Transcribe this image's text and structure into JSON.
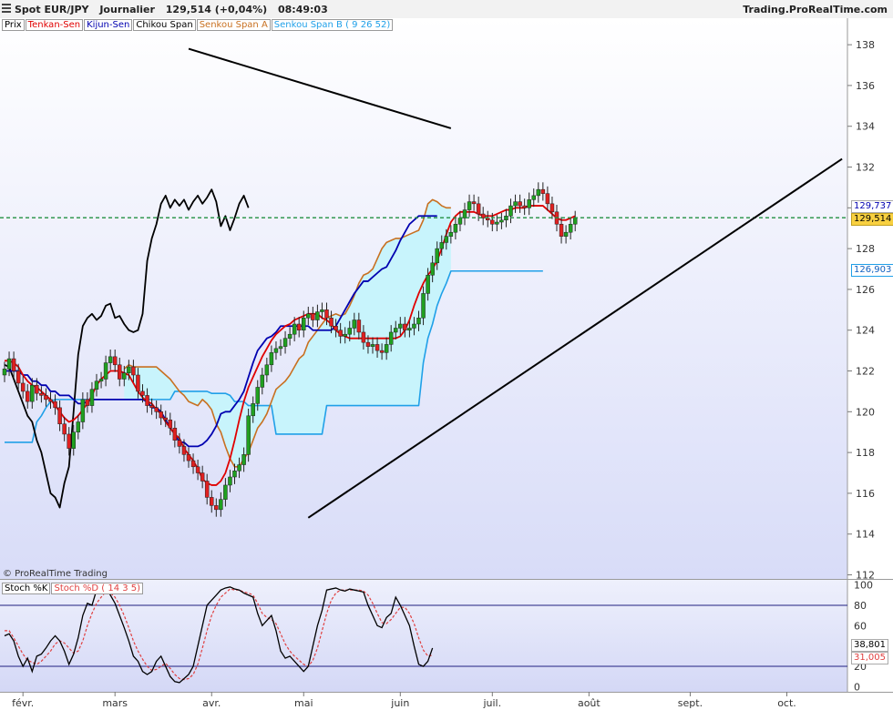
{
  "header": {
    "instrument": "Spot EUR/JPY",
    "timeframe": "Journalier",
    "last": "129,514 (+0,04%)",
    "time": "08:49:03",
    "brand": "Trading.ProRealTime.com"
  },
  "legend": {
    "price": "Prix",
    "tenkan": "Tenkan-Sen",
    "kijun": "Kijun-Sen",
    "chikou": "Chikou Span",
    "spanA": "Senkou Span A",
    "spanB": "Senkou Span B ( 9 26 52)"
  },
  "copyright": "© ProRealTime Trading",
  "stoch_legend": {
    "k": "Stoch %K",
    "d": "Stoch %D ( 14 3 5)"
  },
  "tags": {
    "price": "129,514",
    "spanB": "126,903",
    "hidden": "129,737",
    "k": "38,801",
    "d": "31,005"
  },
  "colors": {
    "tenkan": "#e00000",
    "kijun": "#0000b0",
    "chikou": "#000000",
    "spanA": "#c87020",
    "spanB": "#20a0e8",
    "cloud": "#c8f4fc",
    "up": "#20a020",
    "down": "#e02020",
    "stochD": "#e04040",
    "band": "#202080"
  },
  "chart_data": [
    {
      "type": "candlestick",
      "title": "Spot EUR/JPY",
      "x_ticks": [
        "févr.",
        "mars",
        "avr.",
        "mai",
        "juin",
        "juil.",
        "août",
        "sept.",
        "oct."
      ],
      "y_ticks": [
        112,
        114,
        116,
        118,
        120,
        122,
        124,
        126,
        128,
        130,
        132,
        134,
        136,
        138
      ],
      "ylim": [
        111.8,
        139.3
      ],
      "xlim": [
        0,
        176
      ],
      "month_starts": [
        4,
        24,
        45,
        65,
        86,
        106,
        127,
        149,
        170
      ],
      "current_price": 129.514,
      "closes": [
        122.1,
        122.6,
        122.0,
        121.4,
        121.0,
        120.5,
        121.3,
        120.9,
        120.8,
        120.6,
        120.5,
        120.2,
        119.4,
        118.9,
        118.2,
        119.0,
        119.5,
        120.6,
        120.3,
        121.1,
        121.5,
        121.6,
        122.4,
        122.7,
        122.3,
        121.6,
        121.9,
        122.2,
        121.8,
        121.0,
        120.8,
        120.3,
        120.2,
        120.0,
        119.7,
        119.6,
        119.2,
        118.6,
        118.3,
        117.9,
        117.6,
        117.3,
        117.0,
        116.6,
        115.8,
        115.4,
        115.2,
        115.7,
        116.4,
        116.8,
        117.1,
        117.4,
        117.9,
        119.8,
        120.4,
        121.2,
        121.8,
        122.3,
        122.9,
        123.1,
        123.2,
        123.6,
        123.8,
        124.3,
        124.0,
        124.6,
        124.8,
        124.5,
        124.9,
        125.0,
        124.6,
        124.2,
        124.0,
        123.7,
        123.8,
        124.1,
        124.5,
        123.9,
        123.4,
        123.2,
        123.3,
        123.0,
        122.9,
        123.3,
        123.9,
        124.1,
        124.3,
        124.0,
        124.1,
        124.3,
        124.6,
        125.8,
        126.7,
        127.3,
        128.0,
        128.3,
        128.6,
        128.8,
        129.2,
        129.5,
        129.9,
        130.3,
        130.2,
        129.7,
        129.5,
        129.4,
        129.2,
        129.3,
        129.4,
        129.6,
        130.1,
        130.3,
        130.1,
        130.0,
        130.4,
        130.6,
        130.9,
        130.7,
        130.2,
        129.8,
        129.2,
        128.6,
        128.8,
        129.2,
        129.5
      ],
      "tenkan": [
        122.5,
        122.5,
        122.4,
        122.2,
        121.8,
        121.5,
        121.3,
        121.2,
        121.0,
        120.8,
        120.6,
        120.3,
        120.0,
        119.7,
        119.5,
        119.6,
        119.8,
        120.1,
        120.4,
        120.8,
        121.3,
        121.6,
        121.8,
        122.0,
        122.0,
        122.0,
        121.9,
        121.8,
        121.4,
        121.0,
        120.7,
        120.5,
        120.4,
        120.1,
        119.9,
        119.5,
        119.2,
        118.9,
        118.7,
        118.2,
        117.9,
        117.6,
        117.2,
        116.7,
        116.5,
        116.4,
        116.4,
        116.6,
        117.0,
        117.7,
        118.6,
        119.6,
        120.5,
        121.2,
        121.7,
        122.2,
        122.7,
        123.1,
        123.5,
        123.8,
        124.0,
        124.2,
        124.3,
        124.5,
        124.6,
        124.7,
        124.8,
        124.8,
        124.8,
        124.6,
        124.5,
        124.3,
        124.0,
        123.8,
        123.7,
        123.6,
        123.6,
        123.6,
        123.6,
        123.6,
        123.6,
        123.6,
        123.6,
        123.6,
        123.6,
        123.6,
        123.7,
        124.0,
        124.5,
        125.2,
        125.8,
        126.3,
        126.7,
        127.0,
        127.4,
        128.0,
        128.7,
        129.3,
        129.6,
        129.8,
        129.8,
        129.8,
        129.8,
        129.7,
        129.6,
        129.6,
        129.6,
        129.7,
        129.8,
        129.9,
        129.9,
        130.0,
        130.0,
        130.0,
        130.1,
        130.1,
        130.1,
        130.1,
        129.9,
        129.7,
        129.5,
        129.4,
        129.4,
        129.5,
        129.6
      ],
      "kijun": [
        122.0,
        122.0,
        122.0,
        122.0,
        121.8,
        121.8,
        121.5,
        121.5,
        121.3,
        121.3,
        121.0,
        121.0,
        120.8,
        120.8,
        120.8,
        120.6,
        120.4,
        120.4,
        120.5,
        120.6,
        120.6,
        120.6,
        120.6,
        120.6,
        120.6,
        120.6,
        120.6,
        120.6,
        120.6,
        120.6,
        120.6,
        120.5,
        120.2,
        120.2,
        120.0,
        119.6,
        119.2,
        118.9,
        118.5,
        118.5,
        118.3,
        118.3,
        118.3,
        118.4,
        118.6,
        118.9,
        119.3,
        119.9,
        120.0,
        120.0,
        120.3,
        120.6,
        121.0,
        121.7,
        122.4,
        123.0,
        123.3,
        123.6,
        123.7,
        123.9,
        124.2,
        124.2,
        124.2,
        124.2,
        124.2,
        124.2,
        124.2,
        124.0,
        124.0,
        124.0,
        124.0,
        124.0,
        124.2,
        124.6,
        125.0,
        125.4,
        125.8,
        126.1,
        126.4,
        126.4,
        126.6,
        126.8,
        127.0,
        127.1,
        127.5,
        127.9,
        128.4,
        128.8,
        129.2,
        129.4,
        129.6,
        129.6,
        129.6,
        129.6,
        129.6
      ],
      "chikou": [
        122.3,
        122.2,
        121.6,
        121.0,
        120.4,
        119.8,
        119.5,
        118.6,
        118.0,
        117.0,
        116.0,
        115.8,
        115.3,
        116.5,
        117.3,
        120.0,
        122.8,
        124.2,
        124.6,
        124.8,
        124.5,
        124.7,
        125.2,
        125.3,
        124.6,
        124.7,
        124.3,
        124.0,
        123.9,
        124.0,
        124.8,
        127.4,
        128.5,
        129.2,
        130.2,
        130.6,
        130.0,
        130.4,
        130.1,
        130.4,
        129.9,
        130.3,
        130.6,
        130.2,
        130.5,
        130.9,
        130.3,
        129.1,
        129.6,
        128.9,
        129.5,
        130.2,
        130.6,
        130.0
      ],
      "spanA": [
        122.1,
        122.3,
        122.2,
        122.2,
        122.2,
        122.2,
        122.2,
        122.2,
        122.0,
        121.8,
        121.6,
        121.3,
        121.0,
        120.8,
        120.5,
        120.4,
        120.3,
        120.6,
        120.4,
        120.1,
        119.4,
        119.0,
        118.3,
        117.7,
        117.3,
        117.3,
        117.7,
        118.0,
        118.6,
        119.2,
        119.5,
        119.9,
        120.5,
        121.1,
        121.3,
        121.5,
        121.8,
        122.2,
        122.6,
        122.8,
        123.4,
        123.7,
        124.0,
        124.3,
        124.6,
        124.7,
        124.8,
        124.7,
        124.8,
        125.2,
        125.7,
        126.3,
        126.7,
        126.8,
        127.0,
        127.5,
        128.0,
        128.3,
        128.4,
        128.5,
        128.5,
        128.6,
        128.7,
        128.8,
        128.9,
        129.4,
        130.2,
        130.4,
        130.3,
        130.1,
        130.0,
        130.0
      ],
      "spanB": [
        118.5,
        118.5,
        118.5,
        118.5,
        118.5,
        118.5,
        118.5,
        119.5,
        119.8,
        120.2,
        120.5,
        120.6,
        120.6,
        120.6,
        120.6,
        120.6,
        120.6,
        120.6,
        120.6,
        120.6,
        120.6,
        120.6,
        120.6,
        120.6,
        120.6,
        120.6,
        120.6,
        120.6,
        120.6,
        120.6,
        120.6,
        120.6,
        120.6,
        120.6,
        120.6,
        120.6,
        120.6,
        121.0,
        121.0,
        121.0,
        121.0,
        121.0,
        121.0,
        121.0,
        121.0,
        120.9,
        120.9,
        120.9,
        120.9,
        120.8,
        120.5,
        120.5,
        120.5,
        120.3,
        120.3,
        120.3,
        120.3,
        120.3,
        120.3,
        118.9,
        118.9,
        118.9,
        118.9,
        118.9,
        118.9,
        118.9,
        118.9,
        118.9,
        118.9,
        118.9,
        120.3,
        120.3,
        120.3,
        120.3,
        120.3,
        120.3,
        120.3,
        120.3,
        120.3,
        120.3,
        120.3,
        120.3,
        120.3,
        120.3,
        120.3,
        120.3,
        120.3,
        120.3,
        120.3,
        120.3,
        120.3,
        122.4,
        123.6,
        124.3,
        125.2,
        125.8,
        126.3,
        126.9,
        126.9,
        126.9,
        126.9,
        126.9,
        126.9,
        126.9,
        126.9,
        126.9,
        126.9,
        126.9,
        126.9,
        126.9,
        126.9,
        126.9,
        126.9,
        126.9,
        126.9,
        126.9,
        126.9,
        126.9
      ],
      "trendlines": [
        {
          "from": [
            40,
            137.8
          ],
          "to": [
            97,
            133.9
          ]
        },
        {
          "from": [
            66,
            114.8
          ],
          "to": [
            182,
            132.4
          ]
        }
      ]
    },
    {
      "type": "line",
      "title": "Stoch %K",
      "y_ticks": [
        0,
        20,
        40,
        60,
        80,
        100
      ],
      "ylim": [
        -5,
        105
      ],
      "bands": [
        20,
        80
      ],
      "k": [
        50,
        52,
        45,
        30,
        20,
        28,
        15,
        30,
        32,
        38,
        45,
        50,
        45,
        35,
        22,
        32,
        48,
        70,
        82,
        80,
        95,
        98,
        97,
        90,
        82,
        70,
        58,
        45,
        30,
        25,
        15,
        12,
        15,
        25,
        30,
        20,
        10,
        5,
        4,
        8,
        12,
        20,
        40,
        60,
        80,
        85,
        90,
        95,
        97,
        98,
        96,
        95,
        92,
        90,
        88,
        72,
        60,
        65,
        70,
        55,
        35,
        28,
        30,
        25,
        20,
        15,
        20,
        40,
        60,
        75,
        95,
        96,
        97,
        95,
        94,
        96,
        95,
        94,
        93,
        80,
        70,
        60,
        58,
        68,
        72,
        88,
        80,
        70,
        60,
        40,
        22,
        20,
        25,
        38
      ],
      "d": [
        55,
        55,
        48,
        40,
        32,
        26,
        24,
        22,
        25,
        30,
        35,
        42,
        45,
        43,
        38,
        33,
        35,
        45,
        60,
        72,
        82,
        88,
        93,
        92,
        88,
        80,
        70,
        58,
        45,
        35,
        27,
        20,
        16,
        17,
        20,
        23,
        18,
        12,
        8,
        7,
        8,
        12,
        22,
        38,
        55,
        70,
        80,
        88,
        92,
        96,
        95,
        95,
        93,
        92,
        90,
        82,
        72,
        68,
        66,
        62,
        52,
        42,
        35,
        30,
        26,
        22,
        20,
        26,
        38,
        55,
        72,
        85,
        92,
        95,
        95,
        95,
        95,
        95,
        94,
        90,
        82,
        72,
        63,
        62,
        66,
        72,
        78,
        78,
        72,
        62,
        48,
        36,
        30,
        31
      ]
    }
  ]
}
